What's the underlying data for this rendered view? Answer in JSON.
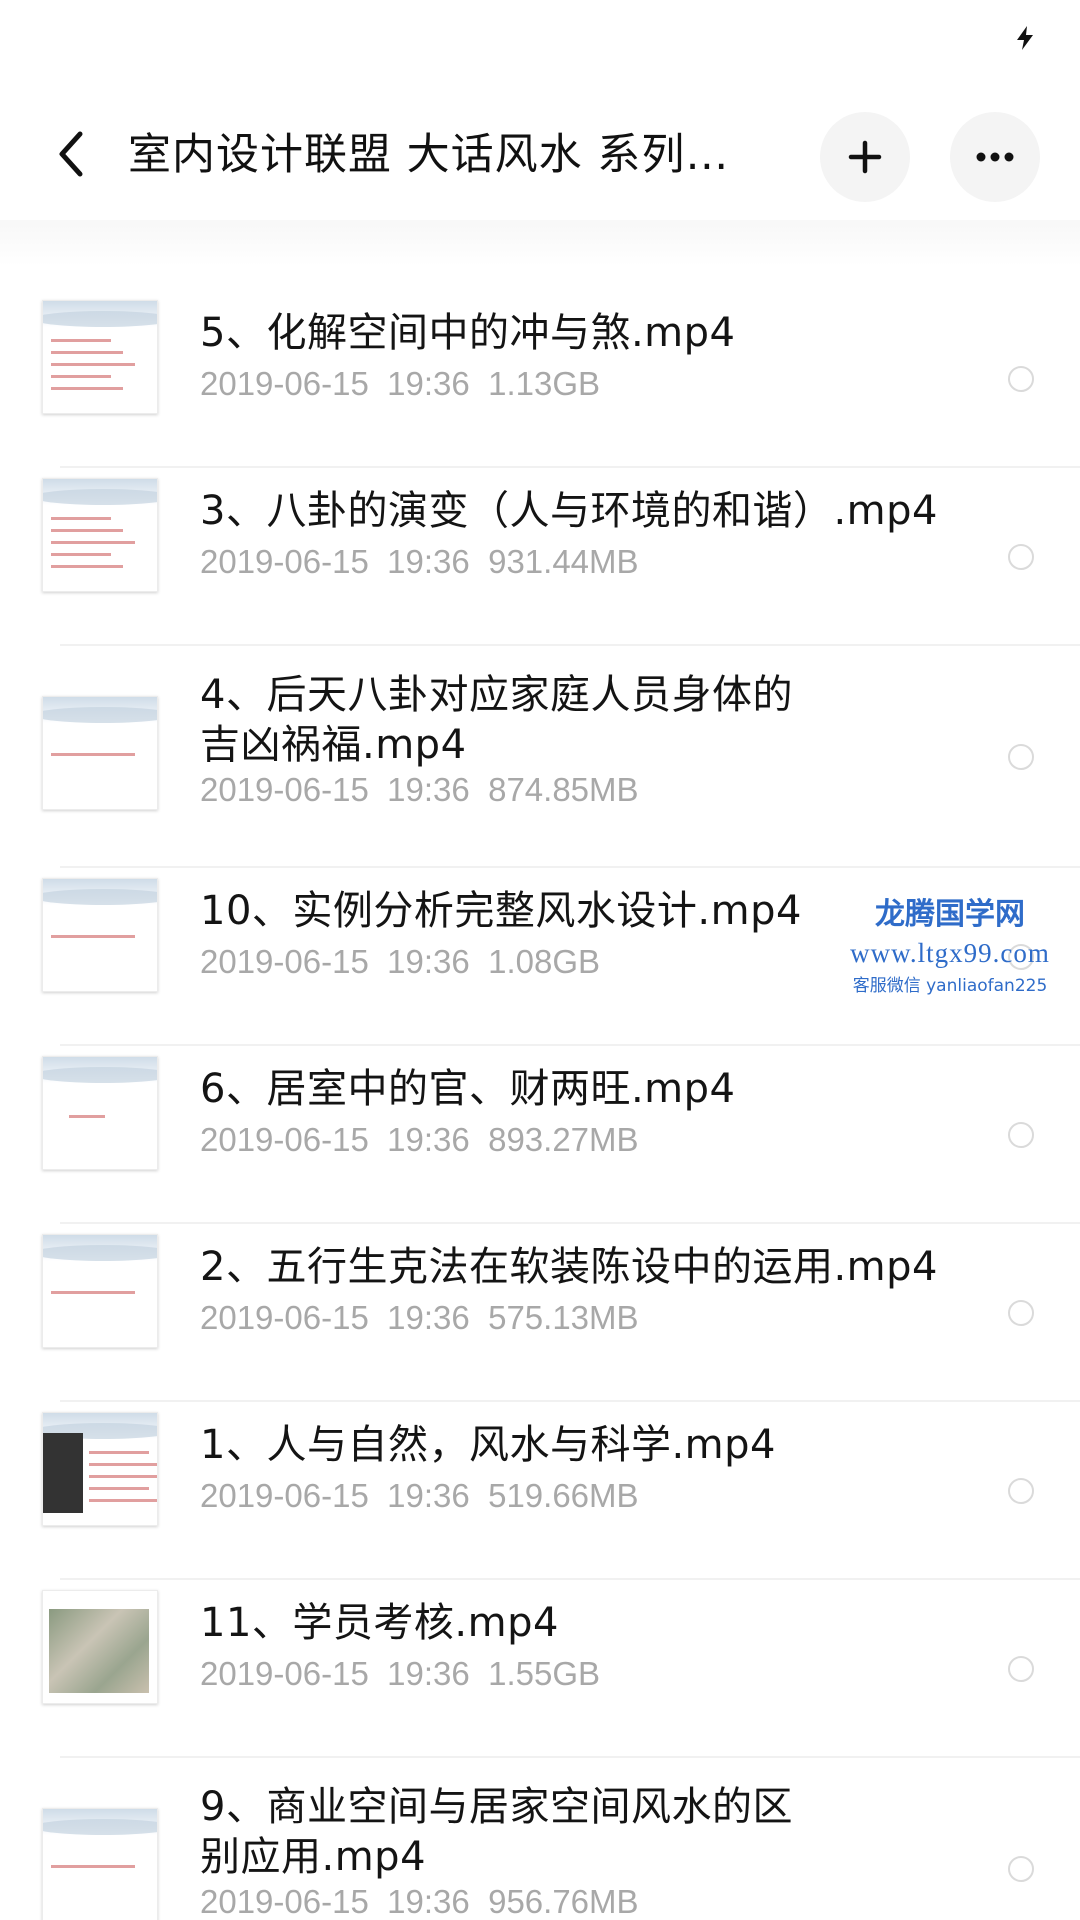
{
  "status_bar": {
    "icon": "lightning-bolt-icon"
  },
  "header": {
    "title": "室内设计联盟 大话风水 系列…",
    "back_icon": "chevron-left-icon",
    "add_icon": "plus-icon",
    "more_icon": "more-dots-icon"
  },
  "files": [
    {
      "name": "5、化解空间中的冲与煞.mp4",
      "date": "2019-06-15",
      "time": "19:36",
      "size": "1.13GB"
    },
    {
      "name": "3、八卦的演变（人与环境的和谐）.mp4",
      "date": "2019-06-15",
      "time": "19:36",
      "size": "931.44MB"
    },
    {
      "name": "4、后天八卦对应家庭人员身体的吉凶祸福.mp4",
      "date": "2019-06-15",
      "time": "19:36",
      "size": "874.85MB"
    },
    {
      "name": "10、实例分析完整风水设计.mp4",
      "date": "2019-06-15",
      "time": "19:36",
      "size": "1.08GB"
    },
    {
      "name": "6、居室中的官、财两旺.mp4",
      "date": "2019-06-15",
      "time": "19:36",
      "size": "893.27MB"
    },
    {
      "name": "2、五行生克法在软装陈设中的运用.mp4",
      "date": "2019-06-15",
      "time": "19:36",
      "size": "575.13MB"
    },
    {
      "name": "1、人与自然，风水与科学.mp4",
      "date": "2019-06-15",
      "time": "19:36",
      "size": "519.66MB"
    },
    {
      "name": "11、学员考核.mp4",
      "date": "2019-06-15",
      "time": "19:36",
      "size": "1.55GB"
    },
    {
      "name": "9、商业空间与居家空间风水的区别应用.mp4",
      "date": "2019-06-15",
      "time": "19:36",
      "size": "956.76MB"
    }
  ],
  "watermark": {
    "title": "龙腾国学网",
    "url": "www.ltgx99.com",
    "contact": "客服微信 yanliaofan225"
  },
  "colors": {
    "text_primary": "#141414",
    "text_secondary": "#a8a8a8",
    "watermark": "#2f6cc9",
    "divider": "#f1f1f1"
  }
}
